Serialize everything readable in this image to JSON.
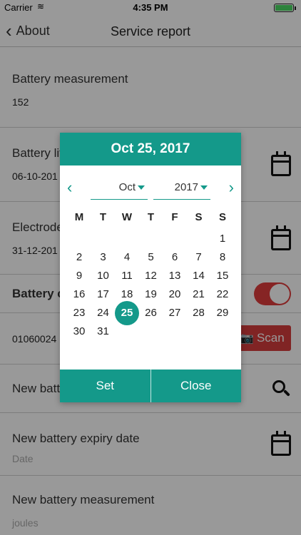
{
  "status": {
    "carrier": "Carrier",
    "time": "4:35 PM"
  },
  "nav": {
    "back": "About",
    "title": "Service report"
  },
  "rows": {
    "battery_measurement_label": "Battery measurement",
    "battery_measurement_value": "152",
    "battery_life_label": "Battery lif",
    "battery_life_value": "06-10-201",
    "electrode_label": "Electrode",
    "electrode_value": "31-12-201",
    "battery_change_label": "Battery c",
    "serial_value": "01060024",
    "scan_label": "Scan",
    "new_battery_label": "New batt",
    "new_expiry_label": "New battery expiry date",
    "new_expiry_placeholder": "Date",
    "new_measurement_label": "New battery measurement",
    "new_measurement_placeholder": "joules"
  },
  "dialog": {
    "header": "Oct 25, 2017",
    "month": "Oct",
    "year": "2017",
    "weekdays": [
      "M",
      "T",
      "W",
      "T",
      "F",
      "S",
      "S"
    ],
    "weeks": [
      [
        "",
        "",
        "",
        "",
        "",
        "",
        "1"
      ],
      [
        "2",
        "3",
        "4",
        "5",
        "6",
        "7",
        "8"
      ],
      [
        "9",
        "10",
        "11",
        "12",
        "13",
        "14",
        "15"
      ],
      [
        "16",
        "17",
        "18",
        "19",
        "20",
        "21",
        "22"
      ],
      [
        "23",
        "24",
        "25",
        "26",
        "27",
        "28",
        "29"
      ],
      [
        "30",
        "31",
        "",
        "",
        "",
        "",
        ""
      ]
    ],
    "selected_day": "25",
    "set_label": "Set",
    "close_label": "Close"
  },
  "colors": {
    "accent": "#14998a",
    "danger": "#d63c3c"
  }
}
